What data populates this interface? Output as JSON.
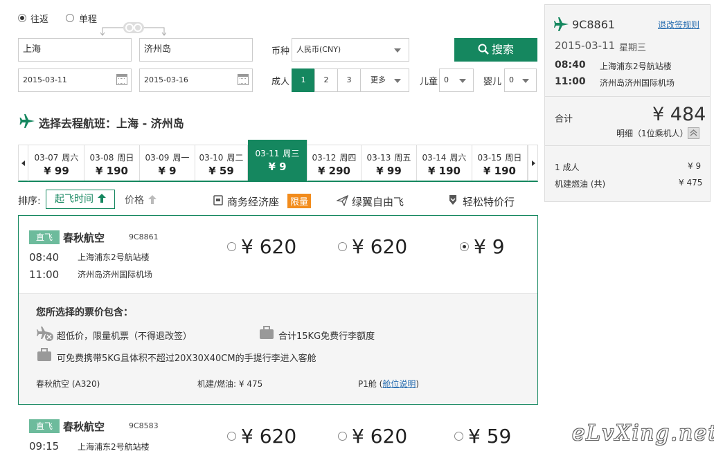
{
  "trip": {
    "round_trip": "往返",
    "one_way": "单程"
  },
  "search": {
    "from": "上海",
    "to": "济州岛",
    "depart_date": "2015-03-11",
    "return_date": "2015-03-16",
    "currency_label": "币种",
    "currency_value": "人民币(CNY)",
    "button": "搜索",
    "adult_label": "成人",
    "adult_options": [
      "1",
      "2",
      "3"
    ],
    "more": "更多",
    "child_label": "儿童",
    "child_value": "0",
    "infant_label": "婴儿",
    "infant_value": "0"
  },
  "section_title": "选择去程航班：上海 - 济州岛",
  "dates": [
    {
      "date": "03-07",
      "week": "周六",
      "price": "¥ 99"
    },
    {
      "date": "03-08",
      "week": "周日",
      "price": "¥ 190"
    },
    {
      "date": "03-09",
      "week": "周一",
      "price": "¥ 9"
    },
    {
      "date": "03-10",
      "week": "周二",
      "price": "¥ 59"
    },
    {
      "date": "03-11",
      "week": "周三",
      "price": "¥ 9"
    },
    {
      "date": "03-12",
      "week": "周四",
      "price": "¥ 290"
    },
    {
      "date": "03-13",
      "week": "周五",
      "price": "¥ 99"
    },
    {
      "date": "03-14",
      "week": "周六",
      "price": "¥ 190"
    },
    {
      "date": "03-15",
      "week": "周日",
      "price": "¥ 190"
    }
  ],
  "sort": {
    "label": "排序:",
    "depart_time": "起飞时间",
    "price": "价格"
  },
  "columns": {
    "business": "商务经济座",
    "limited": "限量",
    "green_wing": "绿翼自由飞",
    "easy_price": "轻松特价行"
  },
  "flight1": {
    "tag": "直飞",
    "airline": "春秋航空",
    "number": "9C8861",
    "dep_time": "08:40",
    "dep_airport": "上海浦东2号航站楼",
    "arr_time": "11:00",
    "arr_airport": "济州岛济州国际机场",
    "price1": "¥ 620",
    "price2": "¥ 620",
    "price3": "¥ 9"
  },
  "details": {
    "title": "您所选择的票价包含：",
    "item1": "超低价，限量机票（不得退改签）",
    "item2": "合计15KG免费行李额度",
    "item3": "可免费携带5KG且体积不超过20X30X40CM的手提行李进入客舱",
    "aircraft": "春秋航空 (A320)",
    "fuel": "机建/燃油: ¥ 475",
    "cabin": "P1舱 (",
    "cabin_link": "舱位说明",
    "cabin_close": ")"
  },
  "flight2": {
    "tag": "直飞",
    "airline": "春秋航空",
    "number": "9C8583",
    "dep_time": "09:15",
    "dep_airport": "上海浦东2号航站楼",
    "price1": "¥ 620",
    "price2": "¥ 620",
    "price3": "¥ 59"
  },
  "summary": {
    "flight_no": "9C8861",
    "rules_link": "退改签规则",
    "date": "2015-03-11",
    "weekday": "星期三",
    "dep_time": "08:40",
    "dep_airport": "上海浦东2号航站楼",
    "arr_time": "11:00",
    "arr_airport": "济州岛济州国际机场",
    "total_label": "合计",
    "total": "¥ 484",
    "detail_label": "明细（1位乘机人）",
    "adult_row": "1 成人",
    "adult_price": "¥ 9",
    "fuel_row": "机建燃油 (共)",
    "fuel_price": "¥ 475"
  },
  "watermark": "eLvXing.net"
}
